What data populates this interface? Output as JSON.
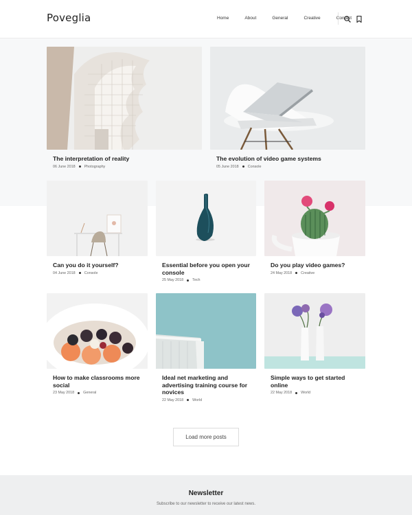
{
  "site": {
    "logo": "Poveglia"
  },
  "nav": {
    "items": [
      "Home",
      "About",
      "General",
      "Creative",
      "Contact"
    ]
  },
  "icons": {
    "search": "search-icon",
    "bookmark": "bookmark-icon"
  },
  "posts": [
    {
      "title": "The interpretation of reality",
      "date": "06 June 2018",
      "category": "Photography",
      "image": "white-curved-architecture"
    },
    {
      "title": "The evolution of video game systems",
      "date": "05 June 2018",
      "category": "Console",
      "image": "laptop-on-white-chair"
    },
    {
      "title": "Can you do it yourself?",
      "date": "04 June 2018",
      "category": "Console",
      "image": "desk-and-chair"
    },
    {
      "title": "Essential before you open your console",
      "date": "25 May 2018",
      "category": "Tech",
      "image": "teal-vase"
    },
    {
      "title": "Do you play video games?",
      "date": "24 May 2018",
      "category": "Creative",
      "image": "cactus-in-mug"
    },
    {
      "title": "How to make classrooms more social",
      "date": "23 May 2018",
      "category": "General",
      "image": "bowl-of-berries"
    },
    {
      "title": "Ideal net marketing and advertising training course for novices",
      "date": "22 May 2018",
      "category": "World",
      "image": "building-and-sky"
    },
    {
      "title": "Simple ways to get started online",
      "date": "22 May 2018",
      "category": "World",
      "image": "flowers-in-vases"
    }
  ],
  "load_more_label": "Load more posts",
  "newsletter": {
    "title": "Newsletter",
    "text": "Subscribe to our newsletter to receive our latest news."
  }
}
